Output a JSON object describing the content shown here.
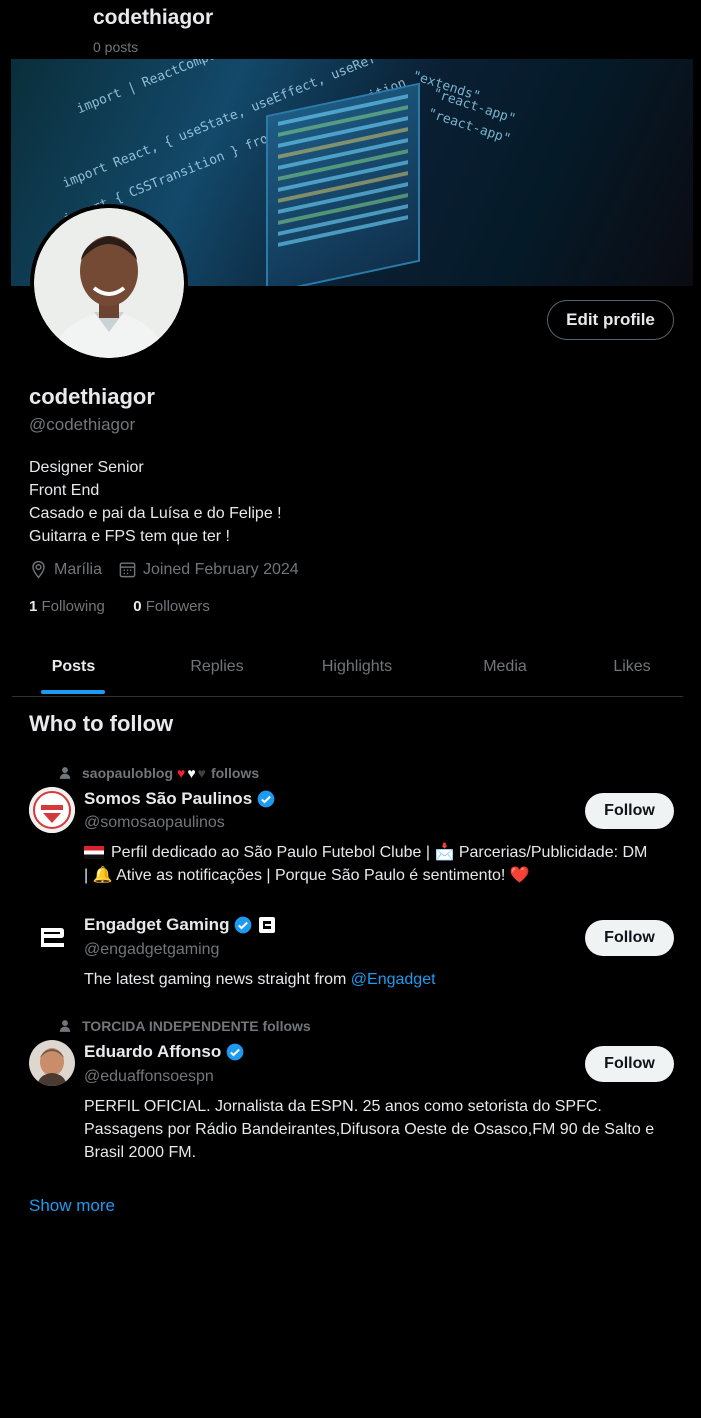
{
  "header": {
    "name": "codethiagor",
    "posts": "0 posts"
  },
  "profile": {
    "edit_label": "Edit profile",
    "display_name": "codethiagor",
    "handle": "@codethiagor",
    "bio": [
      "Designer Senior",
      "Front End",
      "Casado e pai da Luísa e do Felipe !",
      "Guitarra e FPS tem que ter !"
    ],
    "location": "Marília",
    "joined": "Joined February 2024",
    "following_count": "1",
    "following_label": "Following",
    "followers_count": "0",
    "followers_label": "Followers"
  },
  "tabs": [
    {
      "label": "Posts",
      "active": true
    },
    {
      "label": "Replies"
    },
    {
      "label": "Highlights"
    },
    {
      "label": "Media"
    },
    {
      "label": "Likes"
    }
  ],
  "who_to_follow": {
    "title": "Who to follow",
    "follow_label": "Follow",
    "show_more": "Show more",
    "users": [
      {
        "social": "saopauloblog",
        "social_suffix": "follows",
        "name": "Somos São Paulinos",
        "handle": "@somosaopaulinos",
        "desc_line1": "Perfil dedicado ao São Paulo Futebol Clube | 📩 Parcerias/Publicidade: DM",
        "desc_line2": "| 🔔 Ative as notificações | Porque São Paulo é sentimento! ❤️"
      },
      {
        "name": "Engadget Gaming",
        "handle": "@engadgetgaming",
        "desc_prefix": "The latest gaming news straight from ",
        "desc_link": "@Engadget"
      },
      {
        "social": "TORCIDA INDEPENDENTE follows",
        "name": "Eduardo Affonso",
        "handle": "@eduaffonsoespn",
        "desc_line1": "PERFIL OFICIAL. Jornalista da ESPN. 25 anos como setorista do SPFC.",
        "desc_line2": "Passagens por Rádio Bandeirantes,Difusora Oeste de Osasco,FM 90 de Salto e",
        "desc_line3": "Brasil 2000 FM."
      }
    ]
  },
  "colors": {
    "accent": "#1d9bf0",
    "background": "#000000",
    "text": "#e7e9ea",
    "muted": "#71767b"
  }
}
